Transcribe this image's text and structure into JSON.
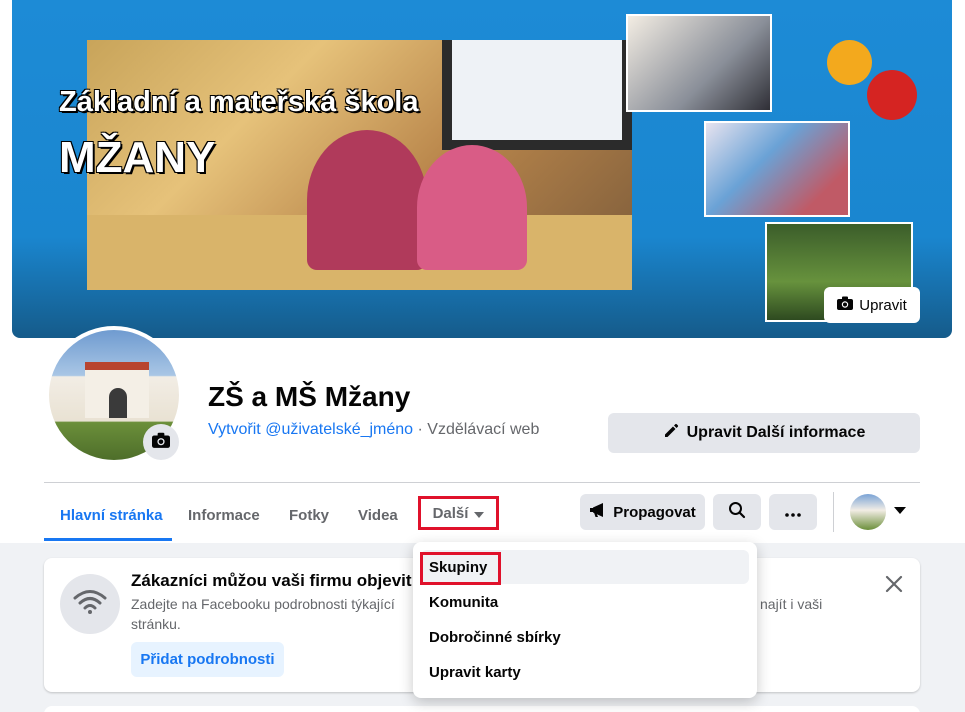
{
  "cover": {
    "title_line1": "Základní a mateřská škola",
    "title_line2": "MŽANY",
    "edit_label": "Upravit"
  },
  "profile": {
    "name": "ZŠ a MŠ Mžany",
    "username_link": "Vytvořit @uživatelské_jméno",
    "separator": " · ",
    "category": "Vzdělávací web",
    "edit_info_label": "Upravit Další informace"
  },
  "tabs": {
    "home": "Hlavní stránka",
    "info": "Informace",
    "photos": "Fotky",
    "videos": "Videa",
    "more": "Další"
  },
  "actions": {
    "promote": "Propagovat"
  },
  "card": {
    "title": "Zákazníci můžou vaši firmu objevit snáze",
    "text_line1": "Zadejte na Facebooku podrobnosti týkající",
    "text_right": "najít i vaši",
    "text_line2": "stránku.",
    "button": "Přidat podrobnosti"
  },
  "dropdown": {
    "items": [
      {
        "label": "Skupiny"
      },
      {
        "label": "Komunita"
      },
      {
        "label": "Dobročinné sbírky"
      },
      {
        "label": "Upravit karty"
      }
    ]
  },
  "colors": {
    "accent": "#1877f2",
    "highlight_box": "#e0112b",
    "button_grey": "#e4e6eb",
    "page_grey": "#f0f2f5"
  },
  "icons": [
    "camera-icon",
    "pencil-icon",
    "caret-down-icon",
    "megaphone-icon",
    "search-icon",
    "more-dots-icon",
    "wifi-icon",
    "close-icon"
  ]
}
